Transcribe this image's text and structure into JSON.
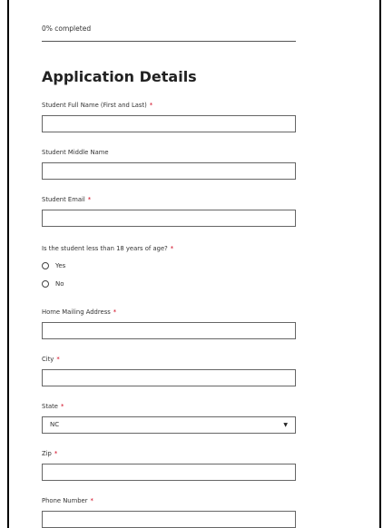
{
  "progress": {
    "text": "0% completed",
    "value_percent": 0
  },
  "form": {
    "title": "Application Details",
    "fields": {
      "full_name": {
        "label": "Student Full Name (First and Last)",
        "required_mark": "*",
        "value": ""
      },
      "middle_name": {
        "label": "Student Middle Name",
        "value": ""
      },
      "email": {
        "label": "Student Email",
        "required_mark": "*",
        "value": ""
      },
      "age_question": {
        "label": "Is the student less than 18 years of age?",
        "required_mark": "*",
        "options": [
          "Yes",
          "No"
        ]
      },
      "address": {
        "label": "Home Mailing Address",
        "required_mark": "*",
        "value": ""
      },
      "city": {
        "label": "City",
        "required_mark": "*",
        "value": ""
      },
      "state": {
        "label": "State",
        "required_mark": "*",
        "value": "NC"
      },
      "zip": {
        "label": "Zip",
        "required_mark": "*",
        "value": ""
      },
      "phone": {
        "label": "Phone Number",
        "required_mark": "*",
        "value": ""
      }
    }
  },
  "colors": {
    "required": "#d0021b",
    "border": "#666666"
  }
}
